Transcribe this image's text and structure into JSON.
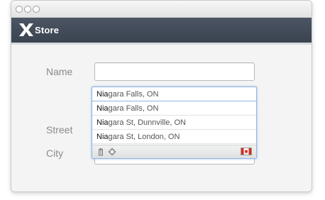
{
  "app": {
    "logo_text": "Store"
  },
  "form": {
    "name_label": "Name",
    "street_label": "Street",
    "city_label": "City",
    "name_value": "",
    "city_value": ""
  },
  "autocomplete": {
    "query_match": "Nia",
    "query_rest": "gara Falls, ON",
    "suggestions": [
      {
        "match": "Nia",
        "rest": "gara Falls, ON"
      },
      {
        "match": "Nia",
        "rest": "gara St, Dunnville, ON"
      },
      {
        "match": "Nia",
        "rest": "gara St, London, ON"
      }
    ],
    "footer_icons": [
      "trash-icon",
      "locate-icon"
    ],
    "country_flag": "canada-flag-icon"
  },
  "colors": {
    "appbar": "#434c59",
    "accent_border": "#8fb6e3",
    "flag_red": "#d52b1e"
  }
}
